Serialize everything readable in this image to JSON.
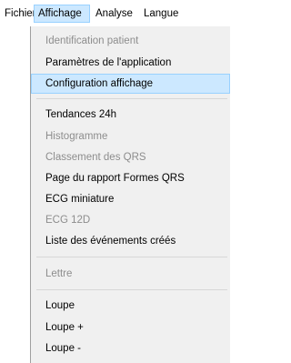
{
  "menubar": {
    "items": [
      {
        "label": "Fichier"
      },
      {
        "label": "Affichage",
        "open": true
      },
      {
        "label": "Analyse"
      },
      {
        "label": "Langue"
      }
    ]
  },
  "menu": {
    "items": [
      {
        "label": "Identification patient",
        "enabled": false
      },
      {
        "label": "Paramètres de l'application",
        "enabled": true
      },
      {
        "label": "Configuration affichage",
        "enabled": true,
        "highlighted": true
      },
      {
        "label": "Tendances 24h",
        "enabled": true
      },
      {
        "label": "Histogramme",
        "enabled": false
      },
      {
        "label": "Classement des QRS",
        "enabled": false
      },
      {
        "label": "Page du rapport Formes QRS",
        "enabled": true
      },
      {
        "label": "ECG miniature",
        "enabled": true
      },
      {
        "label": "ECG 12D",
        "enabled": false
      },
      {
        "label": "Liste des événements créés",
        "enabled": true
      },
      {
        "label": "Lettre",
        "enabled": false
      },
      {
        "label": "Loupe",
        "enabled": true
      },
      {
        "label": "Loupe +",
        "enabled": true
      },
      {
        "label": "Loupe -",
        "enabled": true
      }
    ]
  },
  "colors": {
    "highlight_bg": "#cce8ff",
    "highlight_border": "#99d1ff",
    "menu_bg": "#f0f0f0",
    "disabled_text": "#8d8d8d"
  }
}
